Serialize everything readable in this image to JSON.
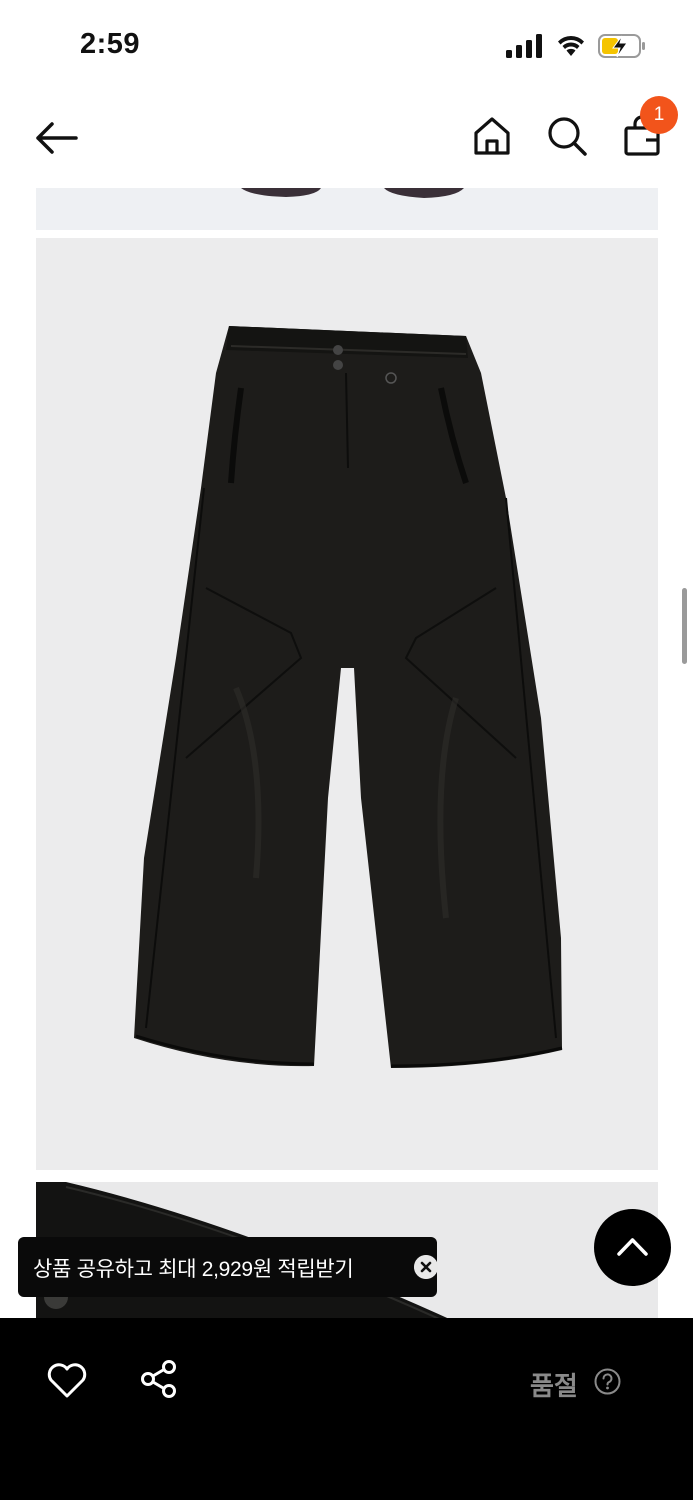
{
  "status_bar": {
    "time": "2:59"
  },
  "header": {
    "back_icon": "arrow-left-icon",
    "home_icon": "home-icon",
    "search_icon": "search-icon",
    "cart_icon": "shopping-bag-icon",
    "cart_count": "1",
    "badge_color": "#f2541b"
  },
  "toast": {
    "message": "상품 공유하고 최대 2,929원 적립받기",
    "close_icon": "close-circle-icon"
  },
  "bottom_bar": {
    "like_icon": "heart-icon",
    "share_icon": "share-icon",
    "status_label": "품절",
    "help_icon": "question-circle-icon"
  },
  "scroll_top_icon": "chevron-up-icon"
}
